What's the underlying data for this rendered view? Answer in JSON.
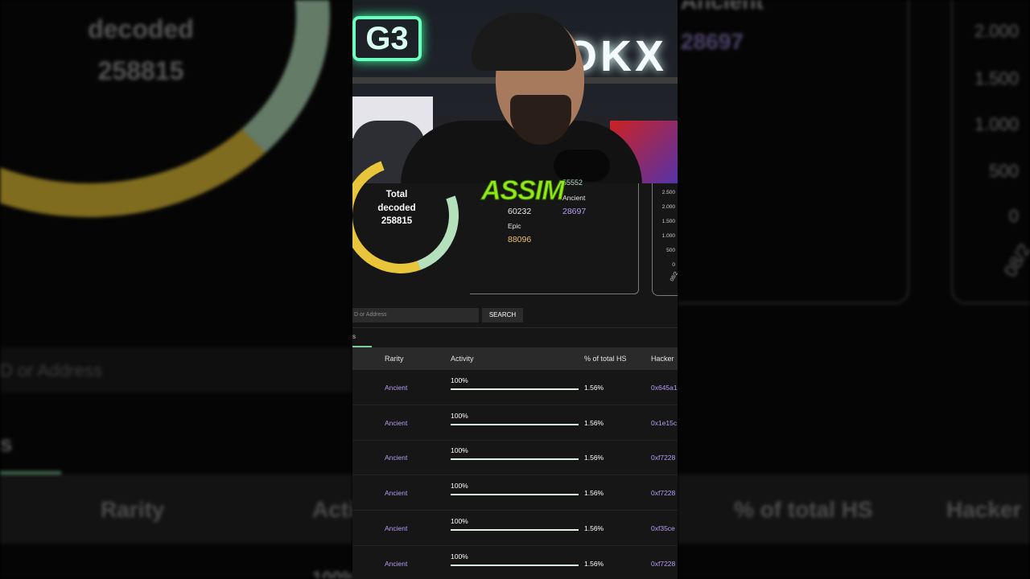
{
  "background_left": {
    "donut_line1": "decoded",
    "donut_line2": "258815",
    "search_placeholder": "D or Address",
    "tab_fragment": "s",
    "header_rarity": "Rarity",
    "header_activity": "Acti",
    "row_fragment": "100%"
  },
  "background_right": {
    "label_top": "Ancient",
    "value_top": "28697",
    "axis": [
      "2.000",
      "1.500",
      "1.000",
      "500",
      "0",
      "08/2"
    ],
    "header_pct": "% of total HS",
    "header_hacker": "Hacker"
  },
  "webcam": {
    "neon_left": "G3",
    "neon_right": "OKX",
    "overlay_caption": "ASSIM"
  },
  "donut": {
    "line1": "Total",
    "line2": "decoded",
    "value": "258815"
  },
  "stats": {
    "top_value_partial": "55552",
    "label_right": "Ancient",
    "value_right": "28697",
    "value_left": "60232",
    "label_epic": "Epic",
    "value_epic": "88096"
  },
  "chart_ticks": [
    "2.500",
    "2.000",
    "1.500",
    "1.000",
    "500",
    "0",
    "08/2"
  ],
  "search": {
    "placeholder": "D or Address",
    "button": "SEARCH"
  },
  "tab": {
    "label": "s"
  },
  "table": {
    "headers": {
      "rarity": "Rarity",
      "activity": "Activity",
      "pct": "% of total HS",
      "hacker": "Hacker"
    },
    "rows": [
      {
        "rarity": "Ancient",
        "activity": "100%",
        "activity_fraction": 1.0,
        "pct": "1.56%",
        "hacker": "0x645a1"
      },
      {
        "rarity": "Ancient",
        "activity": "100%",
        "activity_fraction": 1.0,
        "pct": "1.56%",
        "hacker": "0x1e15c"
      },
      {
        "rarity": "Ancient",
        "activity": "100%",
        "activity_fraction": 1.0,
        "pct": "1.56%",
        "hacker": "0xf7228"
      },
      {
        "rarity": "Ancient",
        "activity": "100%",
        "activity_fraction": 1.0,
        "pct": "1.56%",
        "hacker": "0xf7228"
      },
      {
        "rarity": "Ancient",
        "activity": "100%",
        "activity_fraction": 1.0,
        "pct": "1.56%",
        "hacker": "0xf35ce"
      },
      {
        "rarity": "Ancient",
        "activity": "100%",
        "activity_fraction": 1.0,
        "pct": "1.56%",
        "hacker": "0xf7228"
      }
    ]
  },
  "colors": {
    "accent_green": "#7ecf9a",
    "rarity_purple": "#b59cf2",
    "epic_gold": "#e8c070",
    "donut_yellow": "#e8c53a",
    "caption_green": "#8ee81a"
  }
}
